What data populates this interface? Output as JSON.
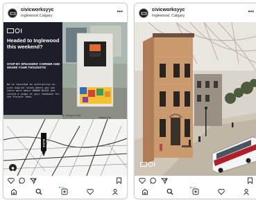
{
  "posts": [
    {
      "username": "civicworksyyc",
      "location": "Inglewood Calgary",
      "promo": {
        "title": "Headed to Inglewood this weekend?",
        "subtitle": "STOP BY SPEAKERS' CORNER AND SHARE YOUR THOUGHTS!",
        "body": "We've launched an interactive on-site digital kiosk where you can learn more about URBAN BLOCK and record a video of your feedback for the Project Team.",
        "map_labels": [
          "St. George's Drive",
          "Calgary Zoo"
        ],
        "pin_label": "BLOCK"
      },
      "carousel": {
        "count": 3,
        "active": 1
      }
    },
    {
      "username": "civicworksyyc",
      "location": "Inglewood, Calgary",
      "carousel": {
        "count": 3,
        "active": 1
      }
    }
  ],
  "icons": {
    "action_row": [
      "heart-icon",
      "comment-icon",
      "share-icon",
      "bookmark-icon"
    ],
    "tab_bar": [
      "home-icon",
      "search-icon",
      "new-post-icon",
      "activity-icon",
      "profile-icon"
    ]
  },
  "colors": {
    "promo_panel": "#1c1f2a",
    "carousel_active": "#3897f0",
    "bus_red": "#b01e2a"
  }
}
